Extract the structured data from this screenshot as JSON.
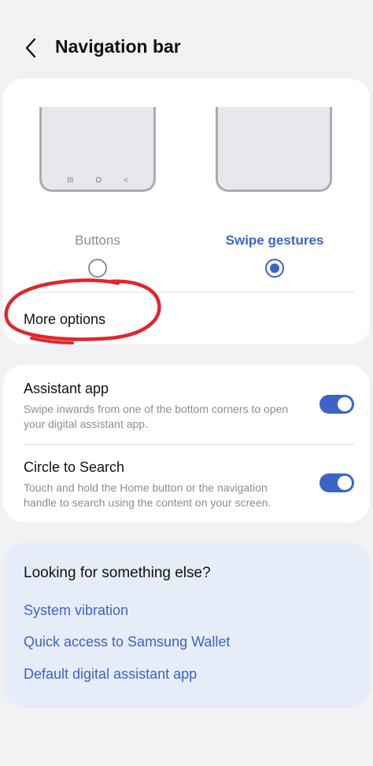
{
  "header": {
    "title": "Navigation bar",
    "back_icon": "chevron-left-icon"
  },
  "navigation_type": {
    "options": [
      {
        "label": "Buttons",
        "selected": false
      },
      {
        "label": "Swipe gestures",
        "selected": true
      }
    ],
    "nav_keys": [
      "III",
      "O",
      "<"
    ],
    "more_options_label": "More options"
  },
  "settings": {
    "assistant_app": {
      "title": "Assistant app",
      "description": "Swipe inwards from one of the bottom corners to open your digital assistant app.",
      "enabled": true
    },
    "circle_to_search": {
      "title": "Circle to Search",
      "description": "Touch and hold the Home button or the navigation handle to search using the content on your screen.",
      "enabled": true
    }
  },
  "suggestions": {
    "title": "Looking for something else?",
    "links": [
      "System vibration",
      "Quick access to Samsung Wallet",
      "Default digital assistant app"
    ]
  },
  "colors": {
    "accent": "#3b64c8",
    "background": "#f2f2f4",
    "card": "#ffffff",
    "suggestion_card": "#e7edf8",
    "annotation": "#e0262b"
  }
}
